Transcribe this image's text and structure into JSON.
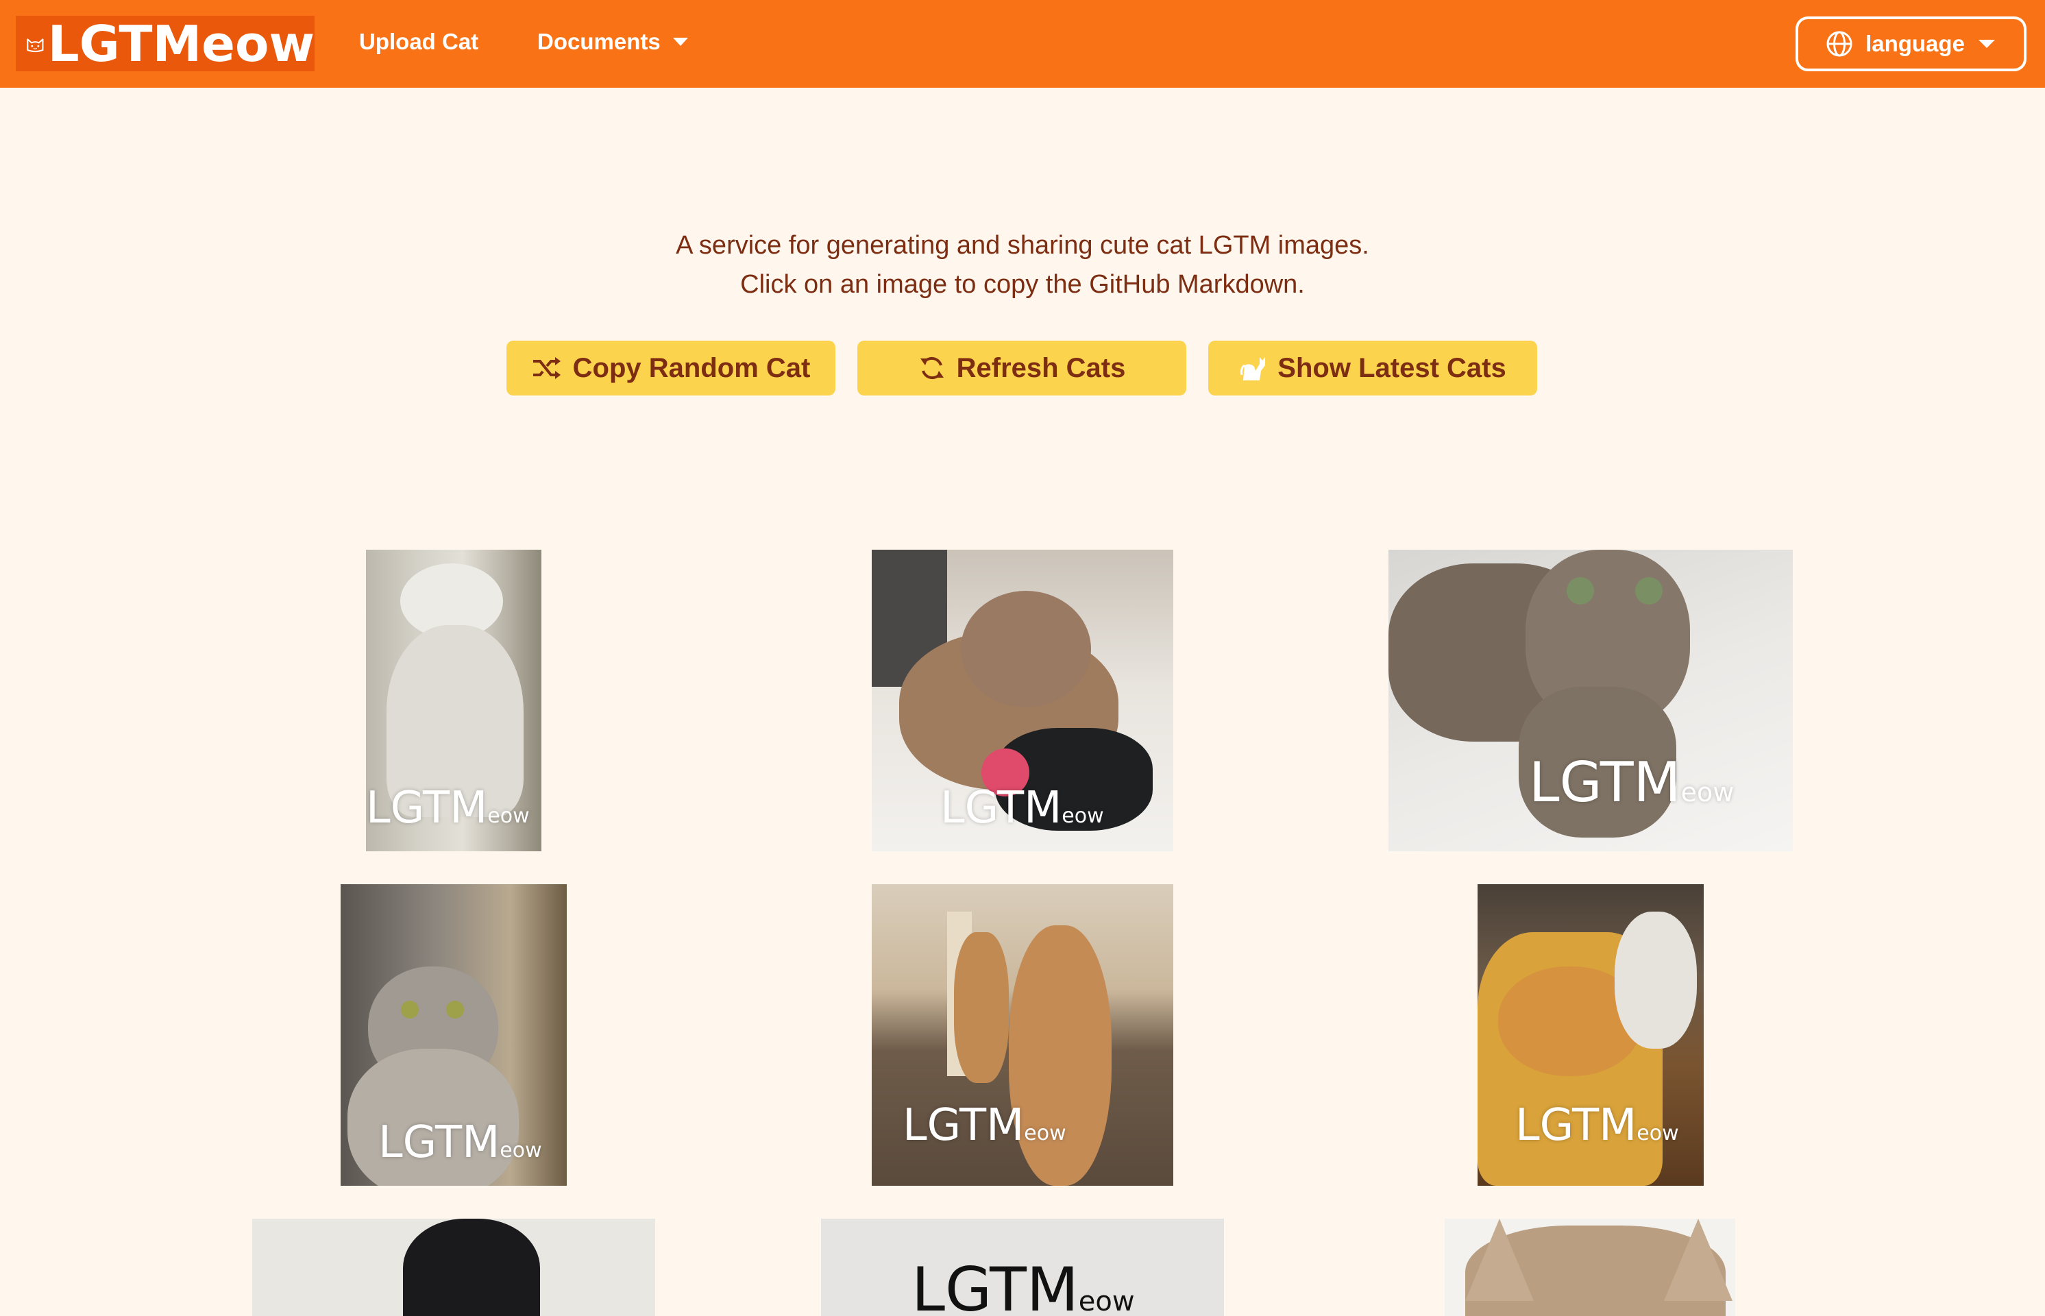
{
  "header": {
    "logo_text": "LGTMeow",
    "nav_upload": "Upload Cat",
    "nav_documents": "Documents",
    "language_label": "language"
  },
  "intro": {
    "line1": "A service for generating and sharing cute cat LGTM images.",
    "line2": "Click on an image to copy the GitHub Markdown."
  },
  "actions": {
    "copy_random": "Copy Random Cat",
    "refresh": "Refresh Cats",
    "show_latest": "Show Latest Cats"
  },
  "watermark": {
    "big": "LGTM",
    "small": "eow"
  },
  "colors": {
    "header_bg": "#f97316",
    "logo_bg": "#ea580c",
    "page_bg": "#fff7ed",
    "button_bg": "#fcd34d",
    "text": "#7c2d12"
  },
  "cats": [
    {
      "description": "white persian cat sitting"
    },
    {
      "description": "orange-grey cat lying on a game controller"
    },
    {
      "description": "tabby cat lying on white sheets looking up"
    },
    {
      "description": "silver tabby cat sitting indoors"
    },
    {
      "description": "two orange cats standing on a wooden floor"
    },
    {
      "description": "orange cat sleeping in a basket with calico cat"
    },
    {
      "description": "black cat ears (cropped)"
    },
    {
      "description": "LGTMeow text image (cropped)"
    },
    {
      "description": "tan cat head from behind (cropped)"
    }
  ]
}
